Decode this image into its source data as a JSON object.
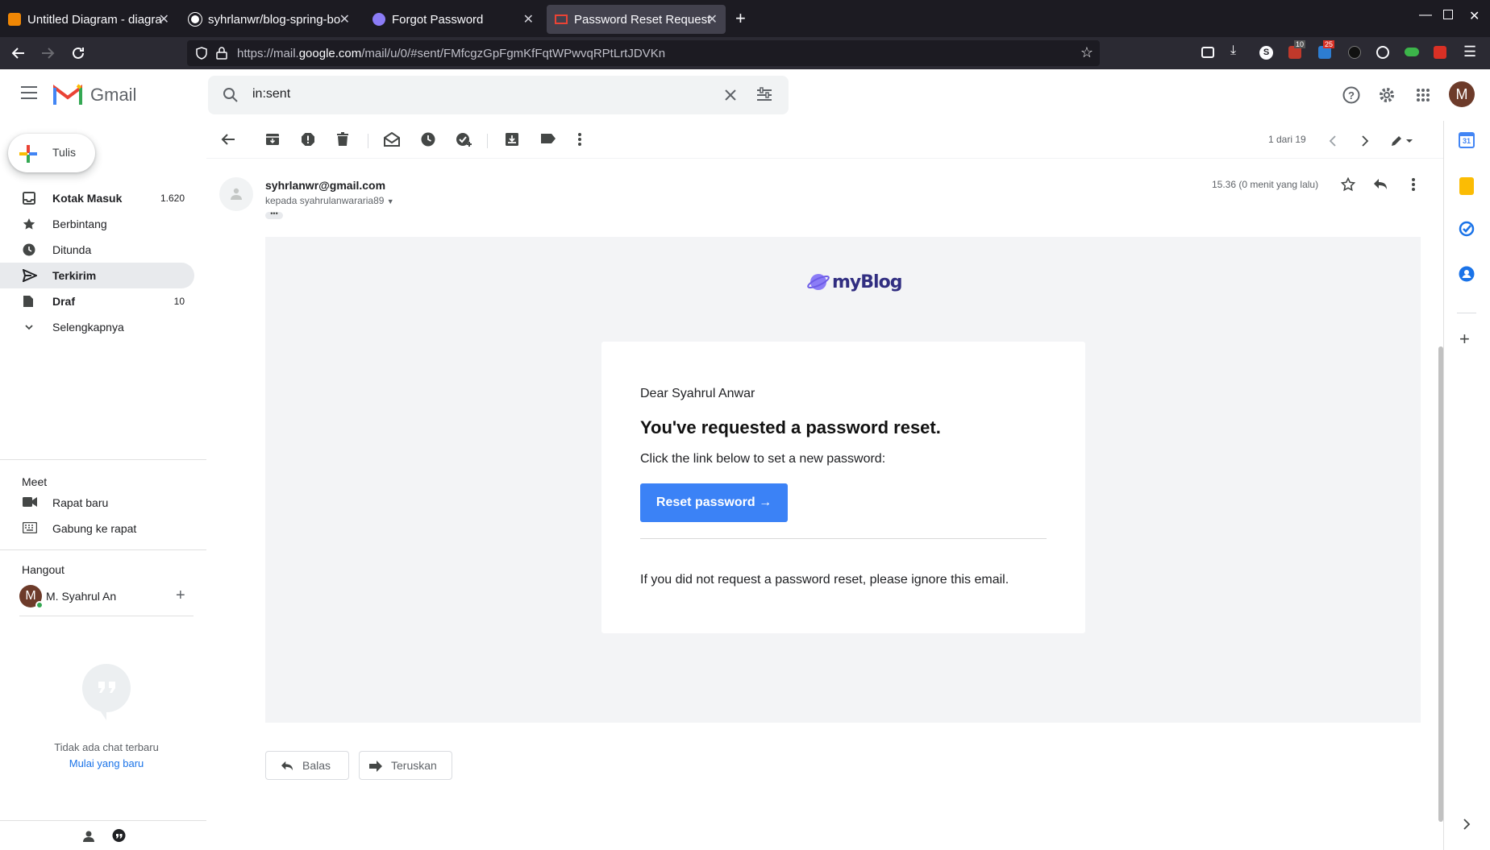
{
  "browser": {
    "tabs": [
      {
        "title": "Untitled Diagram - diagra",
        "active": false
      },
      {
        "title": "syhrlanwr/blog-spring-bo",
        "active": false
      },
      {
        "title": "Forgot Password",
        "active": false
      },
      {
        "title": "Password Reset Request",
        "active": true
      }
    ],
    "url_prefix": "https://mail.",
    "url_domain": "google.com",
    "url_suffix": "/mail/u/0/#sent/FMfcgzGpFgmKfFqtWPwvqRPtLrtJDVKn",
    "ext_badge_1": "10",
    "ext_badge_2": "25"
  },
  "gmail": {
    "logo_text": "Gmail",
    "search_value": "in:sent",
    "avatar_letter": "M",
    "compose_label": "Tulis",
    "nav": [
      {
        "label": "Kotak Masuk",
        "count": "1.620",
        "icon": "inbox-icon"
      },
      {
        "label": "Berbintang",
        "count": "",
        "icon": "star-icon"
      },
      {
        "label": "Ditunda",
        "count": "",
        "icon": "clock-icon"
      },
      {
        "label": "Terkirim",
        "count": "",
        "icon": "send-icon"
      },
      {
        "label": "Draf",
        "count": "10",
        "icon": "draft-icon"
      },
      {
        "label": "Selengkapnya",
        "count": "",
        "icon": "chevron-down-icon"
      }
    ],
    "meet": {
      "title": "Meet",
      "new_meeting": "Rapat baru",
      "join_meeting": "Gabung ke rapat"
    },
    "hangout": {
      "title": "Hangout",
      "user": "M. Syahrul An",
      "no_chats": "Tidak ada chat terbaru",
      "start_new": "Mulai yang baru"
    },
    "pagination": "1 dari 19"
  },
  "email": {
    "sender": "syhrlanwr@gmail.com",
    "to": "kepada syahrulanwararia89",
    "time": "15.36 (0 menit yang lalu)",
    "logo_text": "myBlog",
    "greeting": "Dear Syahrul Anwar",
    "headline": "You've requested a password reset.",
    "instruction": "Click the link below to set a new password:",
    "button": "Reset password →",
    "ignore_note": "If you did not request a password reset, please ignore this email.",
    "reply_label": "Balas",
    "forward_label": "Teruskan"
  },
  "colors": {
    "accent_blue": "#3b82f6",
    "selected_nav": "#e8eaed",
    "email_bg": "#f3f4f6"
  }
}
